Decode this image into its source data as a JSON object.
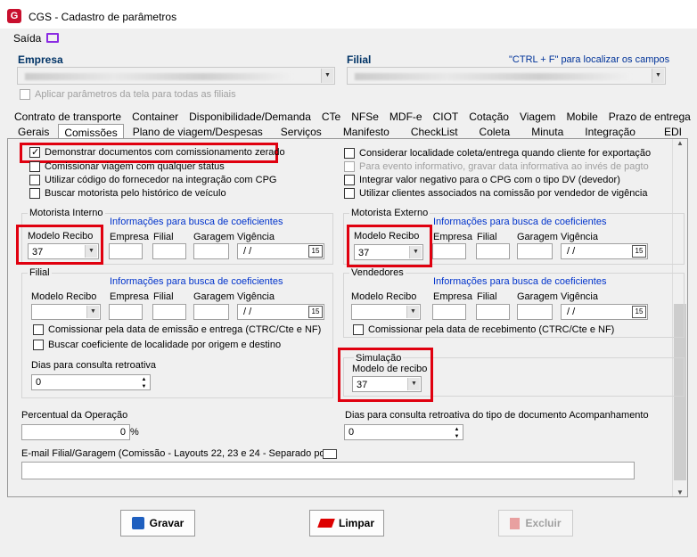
{
  "window": {
    "title": "CGS - Cadastro de parâmetros",
    "icon_letter": "G"
  },
  "menu": {
    "exit_label": "Saída"
  },
  "header": {
    "empresa_label": "Empresa",
    "filial_label": "Filial",
    "search_hint": "\"CTRL + F\" para localizar os campos",
    "apply_all_label": "Aplicar parâmetros da tela para todas as filiais"
  },
  "tabs_row1": [
    "Contrato de transporte",
    "Container",
    "Disponibilidade/Demanda",
    "CTe",
    "NFSe",
    "MDF-e",
    "CIOT",
    "Cotação",
    "Viagem",
    "Mobile",
    "Prazo de entrega"
  ],
  "tabs_row2": [
    "Gerais",
    "Comissões",
    "Plano de viagem/Despesas",
    "Serviços",
    "Manifesto",
    "CheckList",
    "Coleta",
    "Minuta",
    "Integração",
    "EDI"
  ],
  "selected_tab": "Comissões",
  "checks_left": [
    {
      "label": "Demonstrar documentos com comissionamento zerado",
      "checked": true
    },
    {
      "label": "Comissionar viagem com qualquer status",
      "checked": false
    },
    {
      "label": "Utilizar código do fornecedor na integração com CPG",
      "checked": false
    },
    {
      "label": "Buscar motorista pelo histórico de veículo",
      "checked": false
    }
  ],
  "checks_right": [
    {
      "label": "Considerar localidade coleta/entrega quando cliente for exportação",
      "checked": false,
      "disabled": false
    },
    {
      "label": "Para evento informativo, gravar data informativa ao invés de pagto",
      "checked": false,
      "disabled": true
    },
    {
      "label": "Integrar valor negativo para o CPG com o tipo DV (devedor)",
      "checked": false,
      "disabled": false
    },
    {
      "label": "Utilizar clientes associados na comissão por vendedor de vigência",
      "checked": false,
      "disabled": false
    }
  ],
  "coef_info": "Informações para busca de coeficientes",
  "field_labels": {
    "modelo_recibo": "Modelo Recibo",
    "empresa": "Empresa",
    "filial": "Filial",
    "garagem": "Garagem",
    "vigencia": "Vigência",
    "date_placeholder": "/ /",
    "cal_icon": "15"
  },
  "motorista_interno": {
    "title": "Motorista Interno",
    "modelo_recibo": "37"
  },
  "motorista_externo": {
    "title": "Motorista Externo",
    "modelo_recibo": "37"
  },
  "filial_group": {
    "title": "Filial",
    "modelo_recibo": "",
    "check1": "Comissionar pela data de emissão e entrega (CTRC/Cte e NF)",
    "check2": "Buscar coeficiente de localidade por origem e destino",
    "dias_label": "Dias para consulta retroativa",
    "dias_value": "0"
  },
  "vendedores": {
    "title": "Vendedores",
    "modelo_recibo": "",
    "check1": "Comissionar pela data de recebimento (CTRC/Cte e NF)"
  },
  "simulacao": {
    "title": "Simulação",
    "label": "Modelo de recibo",
    "value": "37"
  },
  "percentual": {
    "label": "Percentual da Operação",
    "value": "0",
    "unit": "%"
  },
  "dias_doc": {
    "label": "Dias para consulta retroativa do tipo de documento Acompanhamento",
    "value": "0"
  },
  "email": {
    "label": "E-mail Filial/Garagem (Comissão - Layouts 22, 23 e 24 - Separado por ;)",
    "value": ""
  },
  "buttons": {
    "save": "Gravar",
    "clear": "Limpar",
    "delete": "Excluir"
  },
  "colors": {
    "highlight": "#e0000f",
    "link_blue": "#0033cc",
    "hint_blue": "#003399"
  }
}
